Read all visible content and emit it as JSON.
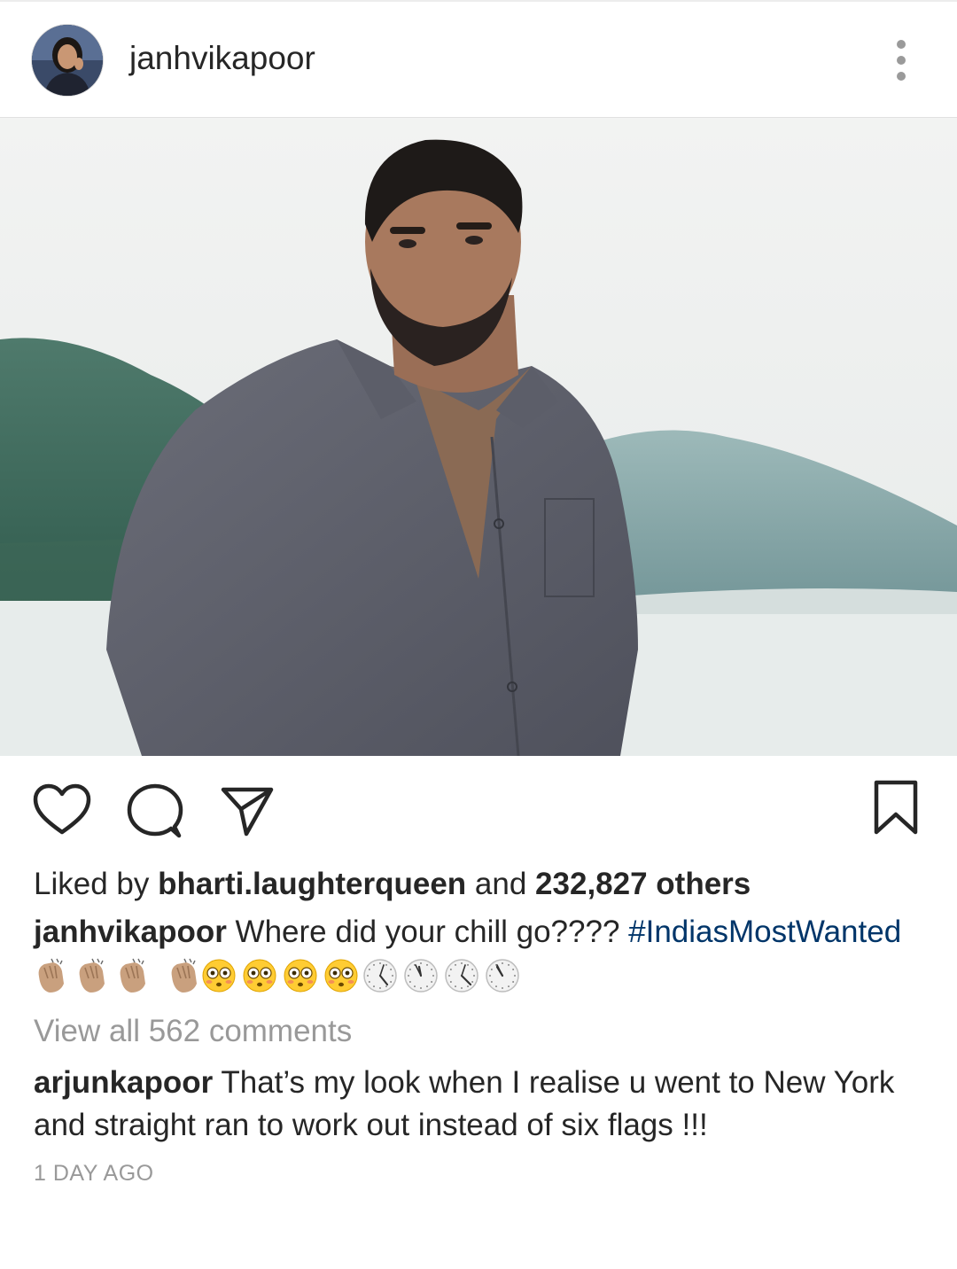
{
  "post": {
    "username": "janhvikapoor",
    "likes": {
      "prefix": "Liked by ",
      "liker": "bharti.laughterqueen",
      "middle": " and ",
      "count": "232,827 others"
    },
    "caption": {
      "username": "janhvikapoor",
      "text": " Where did your chill go???? ",
      "hashtag": "#IndiasMostWanted",
      "emoji_line": "👏🏼👏🏼👏🏼 👏🏼😳😳😳😳🕠🕔🕢🕖"
    },
    "view_all_comments": "View all 562 comments",
    "comment": {
      "username": "arjunkapoor",
      "text": " That’s my look when I realise u went to New York and straight ran to work out instead of six flags !!!"
    },
    "timestamp": "1 DAY AGO"
  },
  "icons": {
    "more": "more-options-icon",
    "like": "heart-icon",
    "comment": "comment-icon",
    "share": "share-icon",
    "save": "bookmark-icon"
  },
  "colors": {
    "text": "#262626",
    "muted": "#999999",
    "hashtag": "#003569"
  }
}
